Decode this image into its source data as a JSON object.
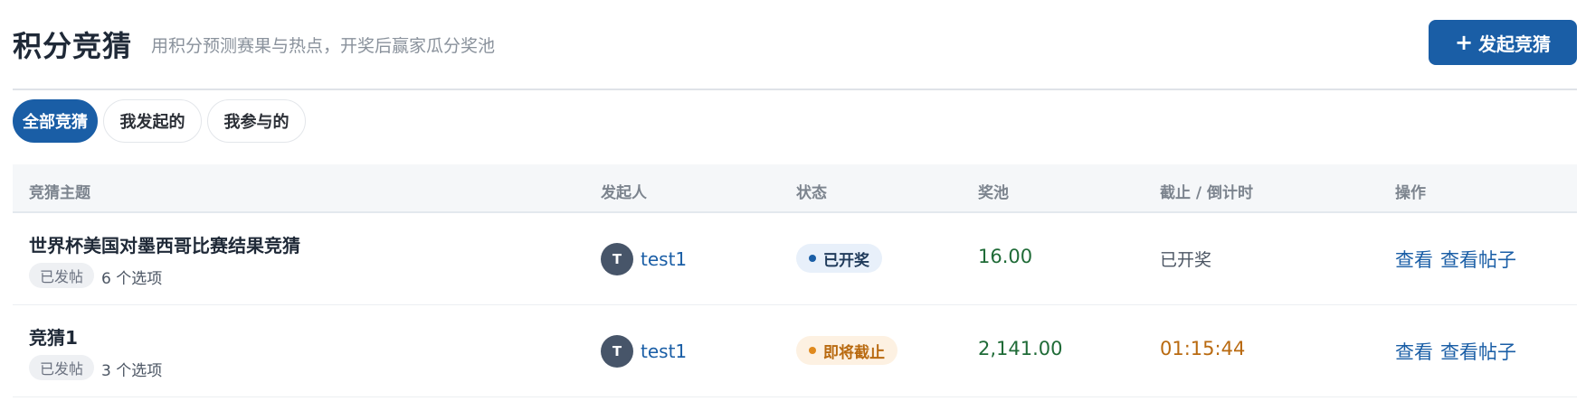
{
  "header": {
    "title": "积分竞猜",
    "subtitle": "用积分预测赛果与热点，开奖后赢家瓜分奖池",
    "create_button": {
      "icon": "plus-icon",
      "symbol": "+",
      "label": "发起竞猜"
    }
  },
  "tabs": [
    {
      "label": "全部竞猜",
      "active": true
    },
    {
      "label": "我发起的",
      "active": false
    },
    {
      "label": "我参与的",
      "active": false
    }
  ],
  "table": {
    "columns": [
      "竞猜主题",
      "发起人",
      "状态",
      "奖池",
      "截止 / 倒计时",
      "操作"
    ],
    "rows": [
      {
        "title": "世界杯美国对墨西哥比赛结果竞猜",
        "post_badge": "已发帖",
        "options_count": "6 个选项",
        "creator": {
          "avatar_letter": "T",
          "name": "test1"
        },
        "status": {
          "label": "已开奖",
          "color": "#1a5ea6"
        },
        "pool": "16.00",
        "deadline": "已开奖",
        "actions": [
          "查看",
          "查看帖子"
        ]
      },
      {
        "title": "竞猜1",
        "post_badge": "已发帖",
        "options_count": "3 个选项",
        "creator": {
          "avatar_letter": "T",
          "name": "test1"
        },
        "status": {
          "label": "即将截止",
          "color": "#e08a1e"
        },
        "pool": "2,141.00",
        "deadline": "01:15:44",
        "actions": [
          "查看",
          "查看帖子"
        ]
      }
    ]
  },
  "colors": {
    "accent": "#1a5ea6",
    "pool_green": "#1f6b37",
    "warning_orange": "#b96a10"
  }
}
